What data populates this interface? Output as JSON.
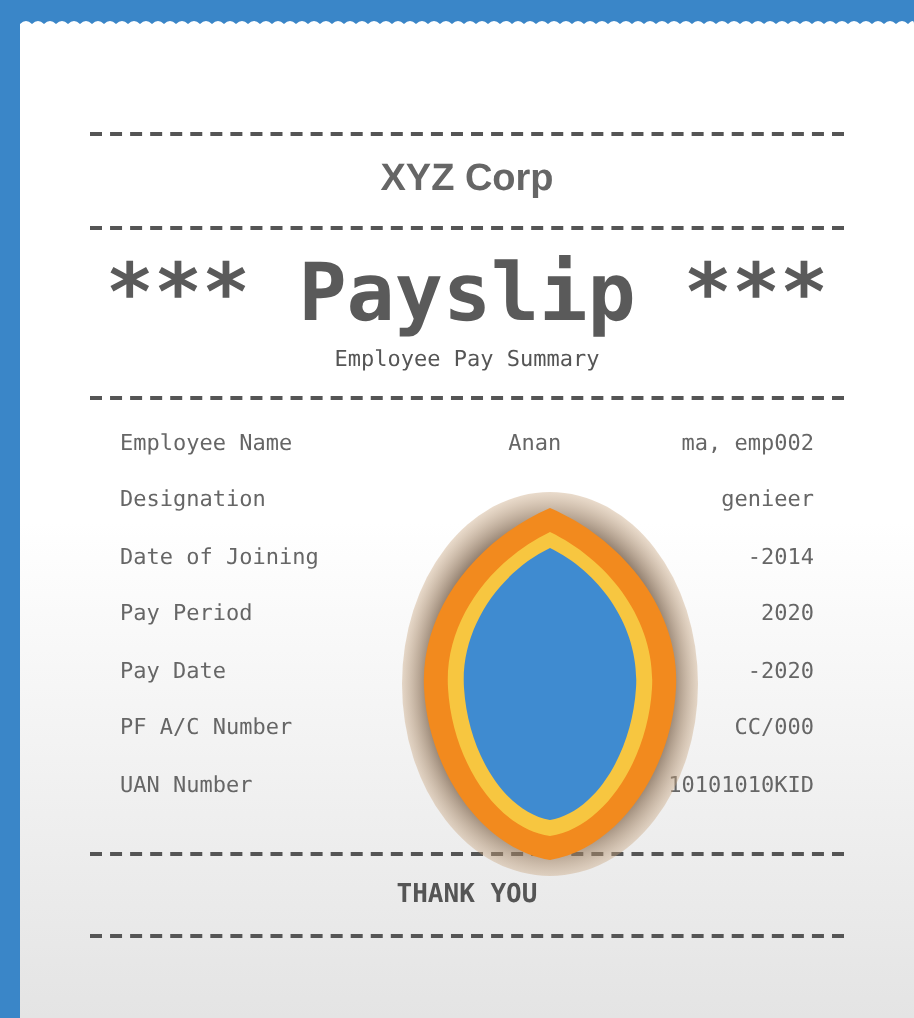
{
  "company": "XYZ Corp",
  "title": "*** Payslip ***",
  "subtitle": "Employee Pay Summary",
  "details": [
    {
      "label": "Employee Name",
      "value_left": "Anan",
      "value": "ma, emp002"
    },
    {
      "label": "Designation",
      "value": "genieer"
    },
    {
      "label": "Date of Joining",
      "value": "-2014"
    },
    {
      "label": "Pay Period",
      "value": "2020"
    },
    {
      "label": "Pay Date",
      "value": "-2020"
    },
    {
      "label": "PF A/C Number",
      "value": "CC/000"
    },
    {
      "label": "UAN Number",
      "value": "10101010KID"
    }
  ],
  "footer": "THANK YOU"
}
